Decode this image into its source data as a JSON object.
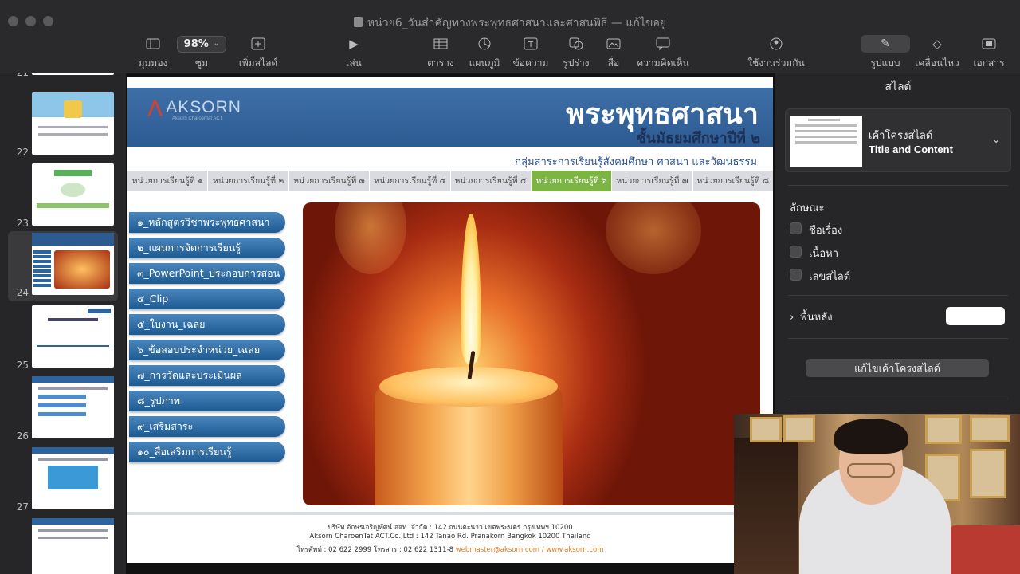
{
  "window": {
    "title": "หน่วย6_วันสำคัญทางพระพุทธศาสนาและศาสนพิธี — แก้ไขอยู่"
  },
  "toolbar": {
    "view_label": "มุมมอง",
    "zoom_value": "98%",
    "zoom_label": "ซูม",
    "add_slide_label": "เพิ่มสไลด์",
    "play_label": "เล่น",
    "table_label": "ตาราง",
    "chart_label": "แผนภูมิ",
    "text_label": "ข้อความ",
    "shape_label": "รูปร่าง",
    "media_label": "สื่อ",
    "comment_label": "ความคิดเห็น",
    "collaborate_label": "ใช้งานร่วมกัน",
    "format_label": "รูปแบบ",
    "animate_label": "เคลื่อนไหว",
    "document_label": "เอกสาร"
  },
  "navigator": {
    "slides": [
      {
        "num": "21"
      },
      {
        "num": "22"
      },
      {
        "num": "23"
      },
      {
        "num": "24",
        "selected": true
      },
      {
        "num": "25"
      },
      {
        "num": "26"
      },
      {
        "num": "27"
      }
    ]
  },
  "slide": {
    "logo_text": "AKSORN",
    "logo_tagline": "Aksorn Charoentat ACT",
    "title": "พระพุทธศาสนา",
    "subtitle": "ชั้นมัธยมศึกษาปีที่ ๒",
    "subject_group": "กลุ่มสาระการเรียนรู้สังคมศึกษา ศาสนา และวัฒนธรรม",
    "tabs": [
      {
        "label": "หน่วยการเรียนรู้ที่ ๑"
      },
      {
        "label": "หน่วยการเรียนรู้ที่ ๒"
      },
      {
        "label": "หน่วยการเรียนรู้ที่ ๓"
      },
      {
        "label": "หน่วยการเรียนรู้ที่ ๔"
      },
      {
        "label": "หน่วยการเรียนรู้ที่ ๕"
      },
      {
        "label": "หน่วยการเรียนรู้ที่ ๖",
        "active": true
      },
      {
        "label": "หน่วยการเรียนรู้ที่ ๗"
      },
      {
        "label": "หน่วยการเรียนรู้ที่ ๘"
      }
    ],
    "menu": [
      {
        "label": "๑_หลักสูตรวิชาพระพุทธศาสนา"
      },
      {
        "label": "๒_แผนการจัดการเรียนรู้"
      },
      {
        "label": "๓_PowerPoint_ประกอบการสอน"
      },
      {
        "label": "๔_Clip"
      },
      {
        "label": "๕_ใบงาน_เฉลย"
      },
      {
        "label": "๖_ข้อสอบประจำหน่วย_เฉลย"
      },
      {
        "label": "๗_การวัดและประเมินผล"
      },
      {
        "label": "๘_รูปภาพ"
      },
      {
        "label": "๙_เสริมสาระ"
      },
      {
        "label": "๑๐_สื่อเสริมการเรียนรู้"
      }
    ],
    "footer": {
      "line1": "บริษัท อักษรเจริญทัศน์ อจท. จำกัด : 142 ถนนตะนาว เขตพระนคร กรุงเทพฯ 10200",
      "line2": "Aksorn CharoenTat ACT.Co.,Ltd : 142 Tanao Rd. Pranakorn Bangkok 10200 Thailand",
      "line3_prefix": "โทรศัพท์ : 02 622 2999  โทรสาร : 02 622 1311-8  ",
      "line3_link": "webmaster@aksorn.com / www.aksorn.com"
    }
  },
  "inspector": {
    "panel_title": "สไลด์",
    "layout_caption": "เค้าโครงสไลด์",
    "layout_name": "Title and Content",
    "appearance_label": "ลักษณะ",
    "checkbox_title": "ชื่อเรื่อง",
    "checkbox_body": "เนื้อหา",
    "checkbox_slide_number": "เลขสไลด์",
    "background_label": "พื้นหลัง",
    "background_color": "#ffffff",
    "edit_layout_button": "แก้ไขเค้าโครงสไลด์"
  },
  "colors": {
    "banner": "#2c5b92",
    "active_tab": "#7db545",
    "menu_button": "#1d5a93",
    "footer_link": "#e07b22"
  }
}
